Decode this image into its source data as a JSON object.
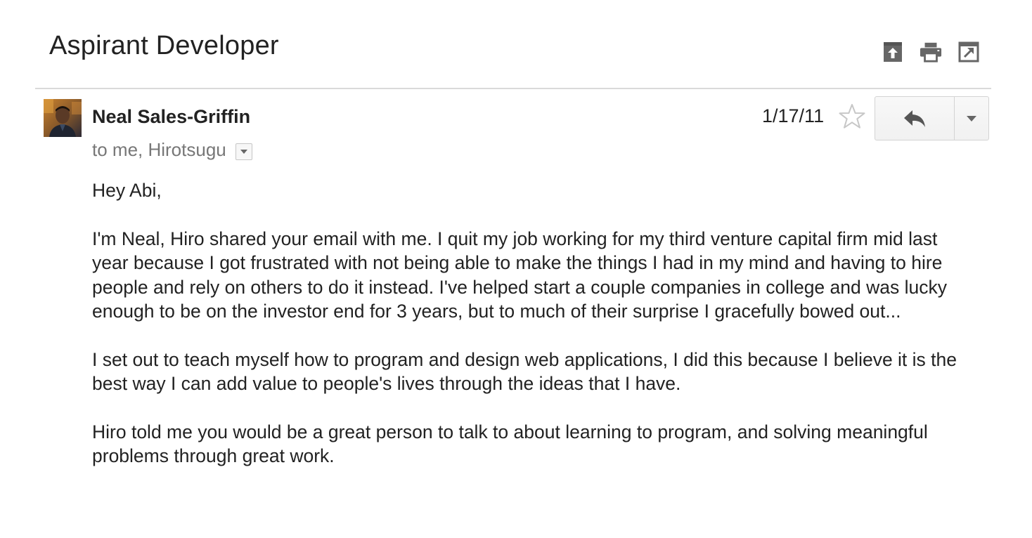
{
  "email": {
    "subject": "Aspirant Developer",
    "sender": "Neal Sales-Griffin",
    "recipients": "to me, Hirotsugu",
    "date": "1/17/11",
    "body": {
      "greeting": "Hey Abi,",
      "paragraph_1": "I'm Neal, Hiro shared your email with me. I quit my job working for my third venture capital firm mid last year because I got frustrated with not being able to make the things I had in my mind and having to hire people and rely on others to do it instead. I've helped start a couple companies in college and was lucky enough to be on the investor end for 3 years, but to much of their surprise I gracefully bowed out...",
      "paragraph_2": "I set out to teach myself how to program and design web applications, I did this because I believe it is the best way I can add value to people's lives through the ideas that I have.",
      "paragraph_3": "Hiro told me you would be a great person to talk to about learning to program, and solving meaningful problems through great work."
    }
  },
  "toolbar": {
    "icons": [
      "archive-icon",
      "print-icon",
      "open-new-window-icon"
    ]
  },
  "colors": {
    "text": "#222222",
    "muted": "#777777",
    "icon": "#666666",
    "divider": "#d9d9d9"
  }
}
